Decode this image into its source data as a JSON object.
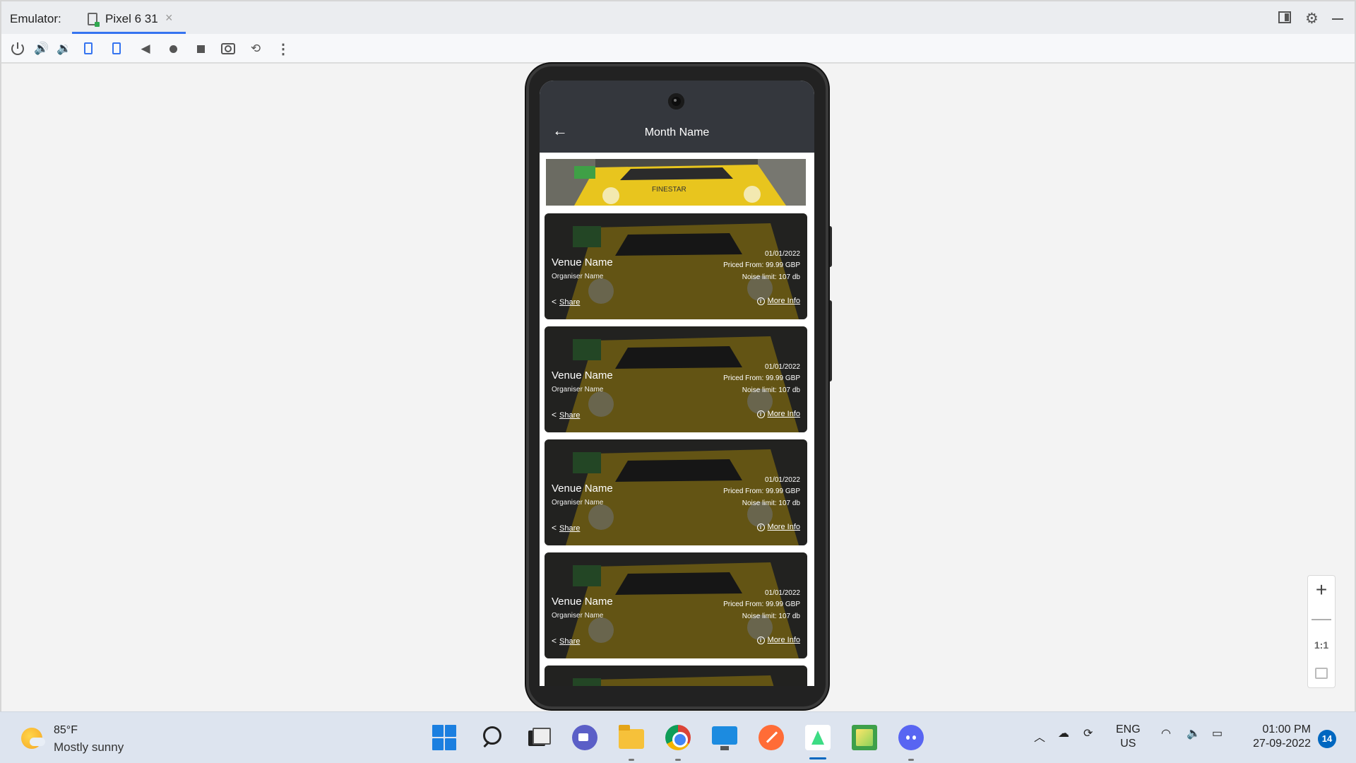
{
  "emulator": {
    "label": "Emulator:",
    "tab_label": "Pixel 6 31",
    "tab_close": "×",
    "zoom_plus": "+",
    "zoom_minus": "—",
    "zoom_one_to_one": "1:1"
  },
  "toolbar": {
    "icons": [
      "power-icon",
      "volume-up-icon",
      "volume-down-icon",
      "rotate-left-icon",
      "rotate-right-icon",
      "back-icon",
      "home-icon",
      "overview-icon",
      "screenshot-icon",
      "snapshot-icon",
      "more-icon"
    ]
  },
  "app": {
    "title": "Month Name",
    "back_glyph": "←",
    "cards": [
      {
        "venue": "Venue Name",
        "organiser": "Organiser Name",
        "date": "01/01/2022",
        "price": "Priced From: 99.99 GBP",
        "noise": "Noise limit: 107 db",
        "share": "Share",
        "more": "More Info"
      },
      {
        "venue": "Venue Name",
        "organiser": "Organiser Name",
        "date": "01/01/2022",
        "price": "Priced From: 99.99 GBP",
        "noise": "Noise limit: 107 db",
        "share": "Share",
        "more": "More Info"
      },
      {
        "venue": "Venue Name",
        "organiser": "Organiser Name",
        "date": "01/01/2022",
        "price": "Priced From: 99.99 GBP",
        "noise": "Noise limit: 107 db",
        "share": "Share",
        "more": "More Info"
      },
      {
        "venue": "Venue Name",
        "organiser": "Organiser Name",
        "date": "01/01/2022",
        "price": "Priced From: 99.99 GBP",
        "noise": "Noise limit: 107 db",
        "share": "Share",
        "more": "More Info"
      }
    ]
  },
  "taskbar": {
    "temperature": "85°F",
    "condition": "Mostly sunny",
    "language": "ENG",
    "region": "US",
    "time": "01:00 PM",
    "date": "27-09-2022",
    "notifications": "14"
  },
  "colors": {
    "appbar": "#34373d",
    "accent": "#3574f0",
    "car_yellow": "#e8c51e"
  }
}
